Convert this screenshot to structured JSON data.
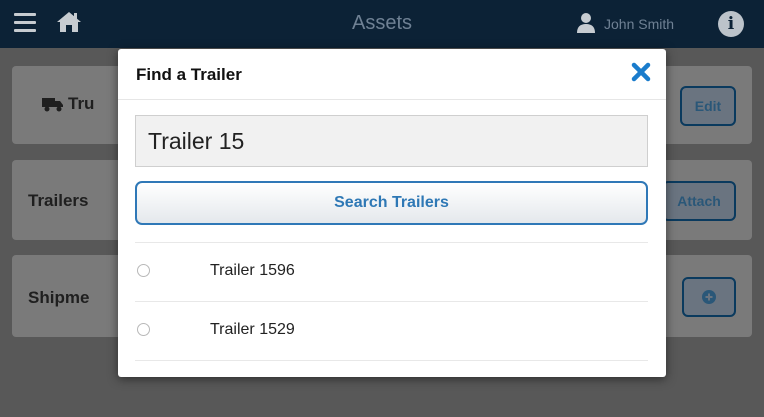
{
  "topbar": {
    "title": "Assets",
    "user_name": "John Smith",
    "info_glyph": "i",
    "icons": [
      "menu-icon",
      "home-icon",
      "user-icon",
      "info-icon"
    ]
  },
  "cards": {
    "trucks_label": "Tru",
    "trucks_button": "Edit",
    "trailers_label": "Trailers",
    "trailers_button": "Attach",
    "shipments_label": "Shipme",
    "shipments_icon": "plus-circle-icon"
  },
  "modal": {
    "title": "Find a Trailer",
    "search_value": "Trailer 15",
    "search_button": "Search Trailers",
    "results": [
      {
        "label": "Trailer 1596"
      },
      {
        "label": "Trailer 1529"
      }
    ]
  },
  "colors": {
    "topbar_bg": "#0c2236",
    "accent": "#2e78b5",
    "close_icon": "#1a7ccc"
  }
}
